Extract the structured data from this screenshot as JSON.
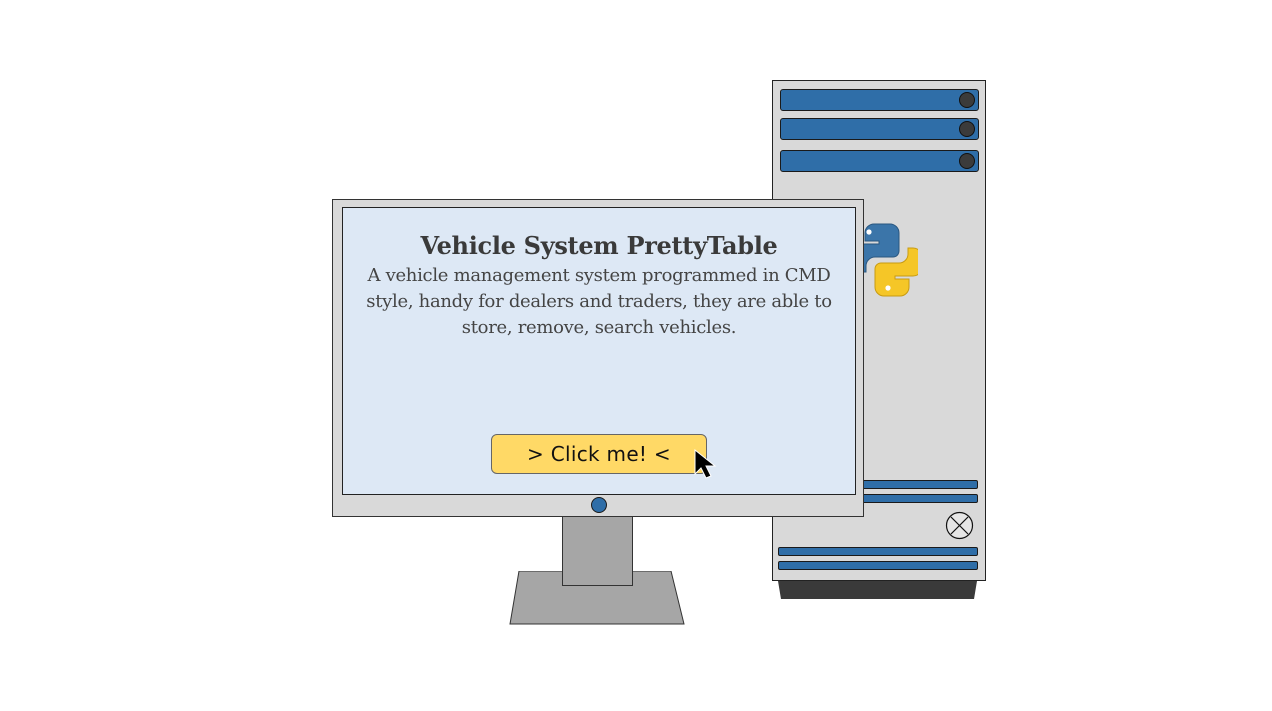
{
  "screen": {
    "title": "Vehicle System PrettyTable",
    "description": "A vehicle management system programmed in CMD style, handy for dealers and traders, they are able to store, remove, search vehicles.",
    "button_label": ">  Click me!  <"
  },
  "icons": {
    "logo": "python-logo-icon",
    "power": "power-button-icon",
    "cursor": "mouse-pointer-icon"
  },
  "colors": {
    "screen_bg": "#dde8f5",
    "button_bg": "#ffd966",
    "bay_blue": "#2f6ea8",
    "case_gray": "#d9d9d9",
    "python_blue": "#3b75a9",
    "python_yellow": "#f5c627"
  }
}
